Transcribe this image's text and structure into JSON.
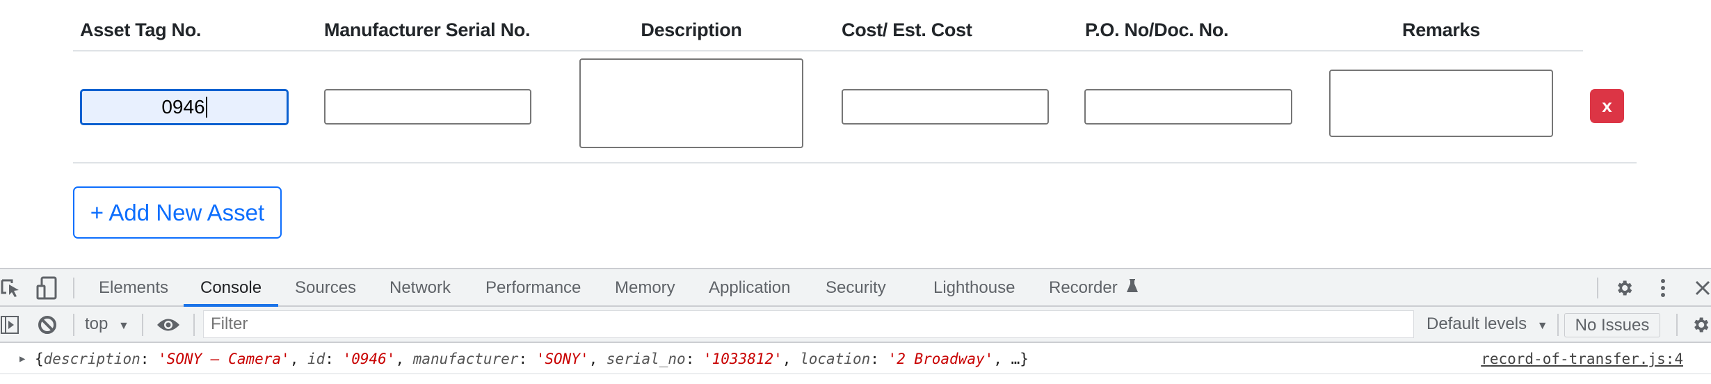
{
  "table": {
    "headers": [
      "Asset Tag No.",
      "Manufacturer Serial No.",
      "Description",
      "Cost/ Est. Cost",
      "P.O. No/Doc. No.",
      "Remarks"
    ],
    "row": {
      "asset_tag": "0946",
      "serial_no": "",
      "description": "",
      "cost": "",
      "po_doc_no": "",
      "remarks": "",
      "remove_label": "x"
    }
  },
  "add_button_label": "+ Add New Asset",
  "colors": {
    "danger": "#dc3545",
    "primary": "#0d6efd",
    "focus_border": "#0b60d0",
    "focus_bg": "#e8f0fe",
    "devtools_active_tab": "#1a73e8",
    "console_string": "#c80000"
  },
  "devtools": {
    "tabs": [
      {
        "label": "Elements",
        "active": false
      },
      {
        "label": "Console",
        "active": true
      },
      {
        "label": "Sources",
        "active": false
      },
      {
        "label": "Network",
        "active": false
      },
      {
        "label": "Performance",
        "active": false
      },
      {
        "label": "Memory",
        "active": false
      },
      {
        "label": "Application",
        "active": false
      },
      {
        "label": "Security",
        "active": false
      },
      {
        "label": "Lighthouse",
        "active": false
      },
      {
        "label": "Recorder",
        "active": false
      }
    ],
    "toolbar": {
      "context": "top",
      "filter_placeholder": "Filter",
      "levels": "Default levels",
      "issues": "No Issues"
    },
    "console": {
      "entries": [
        {
          "object": [
            {
              "key": "description",
              "value": "'SONY – Camera'"
            },
            {
              "key": "id",
              "value": "'0946'"
            },
            {
              "key": "manufacturer",
              "value": "'SONY'"
            },
            {
              "key": "serial_no",
              "value": "'1033812'"
            },
            {
              "key": "location",
              "value": "'2 Broadway'"
            }
          ],
          "truncated": "…",
          "source": "record-of-transfer.js:4"
        }
      ]
    }
  }
}
